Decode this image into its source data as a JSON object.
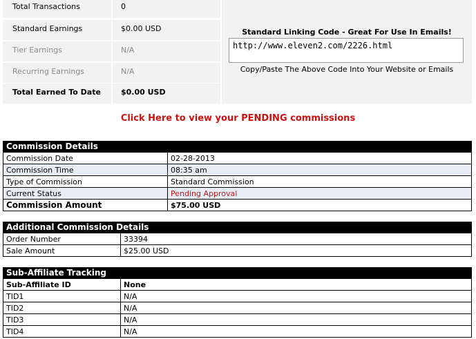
{
  "earnings": [
    {
      "label": "Total Transactions",
      "value": "0",
      "style": "normal"
    },
    {
      "label": "Standard Earnings",
      "value": "$0.00 USD",
      "style": "normal"
    },
    {
      "label": "Tier Earnings",
      "value": "N/A",
      "style": "dim"
    },
    {
      "label": "Recurring Earnings",
      "value": "N/A",
      "style": "dim"
    },
    {
      "label": "Total Earned To Date",
      "value": "$0.00 USD",
      "style": "bold"
    }
  ],
  "linking": {
    "title": "Standard Linking Code - Great For Use In Emails!",
    "code": "http://www.eleven2.com/2226.html",
    "note": "Copy/Paste The Above Code Into Your Website or Emails"
  },
  "pending_link": "Click Here to view your PENDING commissions",
  "commission_details": {
    "title": "Commission Details",
    "rows": [
      {
        "label": "Commission Date",
        "value": "02-28-2013"
      },
      {
        "label": "Commission Time",
        "value": "08:35 am"
      },
      {
        "label": "Type of Commission",
        "value": "Standard Commission"
      },
      {
        "label": "Current Status",
        "value": "Pending Approval"
      },
      {
        "label": "Commission Amount",
        "value": "$75.00 USD"
      }
    ]
  },
  "additional_details": {
    "title": "Additional Commission Details",
    "rows": [
      {
        "label": "Order Number",
        "value": "33394"
      },
      {
        "label": "Sale Amount",
        "value": "$25.00 USD"
      }
    ]
  },
  "sub_affiliate": {
    "title": "Sub-Affiliate Tracking",
    "id_label": "Sub-Affiliate ID",
    "id_value": "None",
    "rows": [
      {
        "label": "TID1",
        "value": "N/A"
      },
      {
        "label": "TID2",
        "value": "N/A"
      },
      {
        "label": "TID3",
        "value": "N/A"
      },
      {
        "label": "TID4",
        "value": "N/A"
      }
    ]
  }
}
